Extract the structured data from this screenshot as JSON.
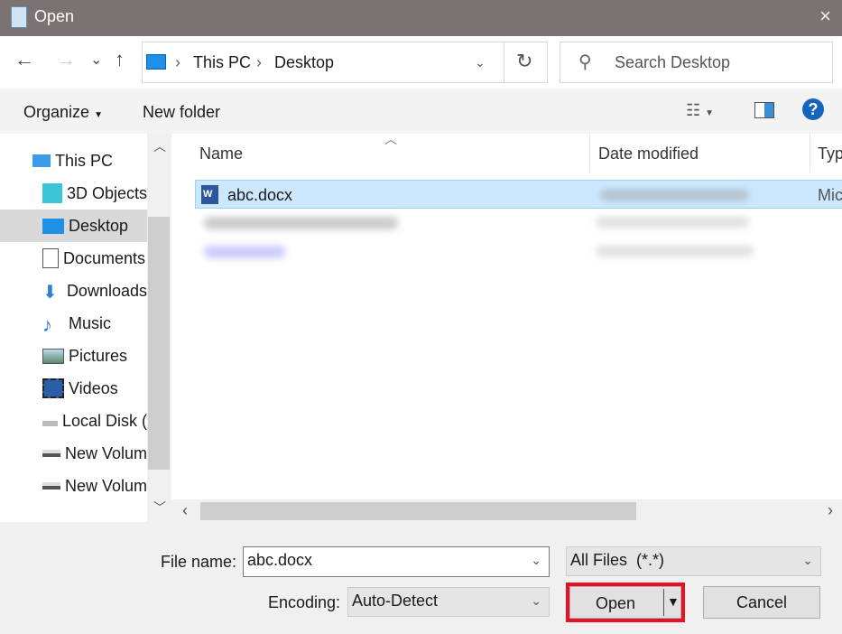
{
  "window": {
    "title": "Open",
    "close_icon": "×"
  },
  "nav": {
    "back": "←",
    "forward": "→",
    "recent": "⌄",
    "up": "↑",
    "breadcrumb": [
      "This PC",
      "Desktop"
    ],
    "refresh": "↻",
    "search_placeholder": "Search Desktop"
  },
  "toolbar": {
    "organize": "Organize",
    "new_folder": "New folder",
    "help": "?"
  },
  "sidebar": {
    "items": [
      {
        "label": "This PC",
        "icon": "pc-icon"
      },
      {
        "label": "3D Objects",
        "icon": "cube-icon"
      },
      {
        "label": "Desktop",
        "icon": "desktop-icon",
        "selected": true
      },
      {
        "label": "Documents",
        "icon": "documents-icon"
      },
      {
        "label": "Downloads",
        "icon": "download-icon"
      },
      {
        "label": "Music",
        "icon": "music-icon"
      },
      {
        "label": "Pictures",
        "icon": "pictures-icon"
      },
      {
        "label": "Videos",
        "icon": "videos-icon"
      },
      {
        "label": "Local Disk (",
        "icon": "drive-icon"
      },
      {
        "label": "New Volum",
        "icon": "drive-icon"
      },
      {
        "label": "New Volum",
        "icon": "drive-icon"
      }
    ]
  },
  "list": {
    "columns": [
      "Name",
      "Date modified",
      "Typ"
    ],
    "files": [
      {
        "name": "abc.docx",
        "type": "Mic",
        "selected": true
      }
    ]
  },
  "footer": {
    "file_name_label": "File name:",
    "file_name": "abc.docx",
    "filter": "All Files  (*.*)",
    "encoding_label": "Encoding:",
    "encoding": "Auto-Detect",
    "open": "Open",
    "cancel": "Cancel"
  },
  "colors": {
    "highlight": "#cce8ff",
    "accent_border": "#e81123"
  }
}
